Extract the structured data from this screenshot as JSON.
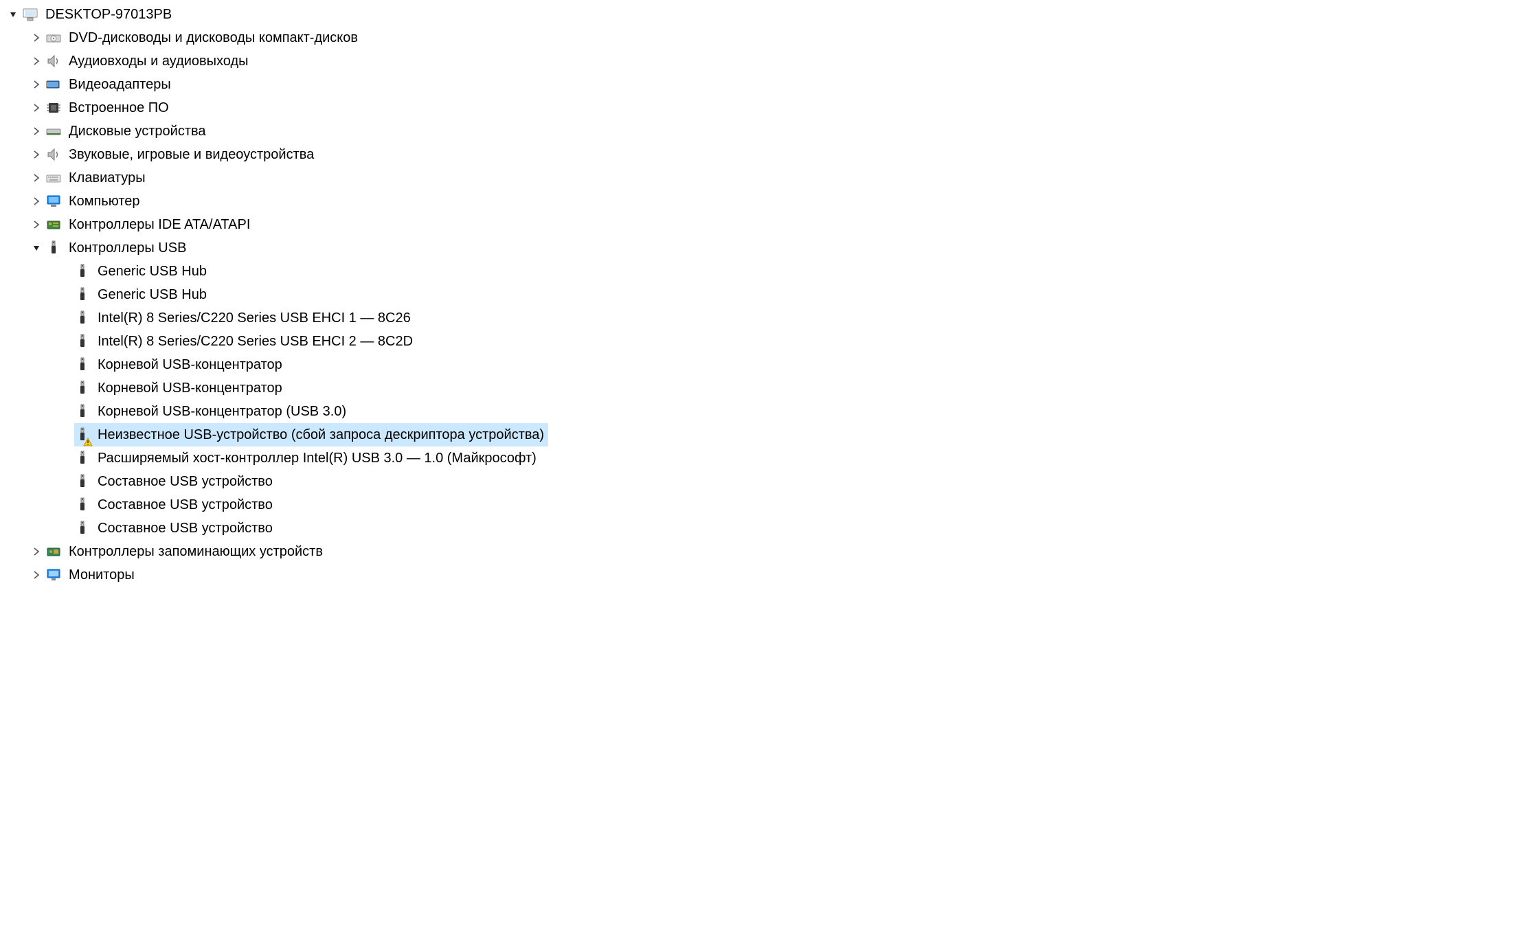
{
  "root": {
    "label": "DESKTOP-97013PB",
    "icon": "computer-icon",
    "expanded": true
  },
  "categories": [
    {
      "label": "DVD-дисководы и дисководы компакт-дисков",
      "icon": "dvd-drive-icon",
      "expanded": false
    },
    {
      "label": "Аудиовходы и аудиовыходы",
      "icon": "audio-io-icon",
      "expanded": false
    },
    {
      "label": "Видеоадаптеры",
      "icon": "display-adapter-icon",
      "expanded": false
    },
    {
      "label": "Встроенное ПО",
      "icon": "firmware-icon",
      "expanded": false
    },
    {
      "label": "Дисковые устройства",
      "icon": "disk-drive-icon",
      "expanded": false
    },
    {
      "label": "Звуковые, игровые и видеоустройства",
      "icon": "sound-device-icon",
      "expanded": false
    },
    {
      "label": "Клавиатуры",
      "icon": "keyboard-icon",
      "expanded": false
    },
    {
      "label": "Компьютер",
      "icon": "pc-icon",
      "expanded": false
    },
    {
      "label": "Контроллеры IDE ATA/ATAPI",
      "icon": "ide-controller-icon",
      "expanded": false
    },
    {
      "label": "Контроллеры USB",
      "icon": "usb-icon",
      "expanded": true,
      "children": [
        {
          "label": "Generic USB Hub",
          "icon": "usb-icon"
        },
        {
          "label": "Generic USB Hub",
          "icon": "usb-icon"
        },
        {
          "label": "Intel(R) 8 Series/C220 Series USB EHCI 1 — 8C26",
          "icon": "usb-icon"
        },
        {
          "label": "Intel(R) 8 Series/C220 Series USB EHCI 2 — 8C2D",
          "icon": "usb-icon"
        },
        {
          "label": "Корневой USB-концентратор",
          "icon": "usb-icon"
        },
        {
          "label": "Корневой USB-концентратор",
          "icon": "usb-icon"
        },
        {
          "label": "Корневой USB-концентратор (USB 3.0)",
          "icon": "usb-icon"
        },
        {
          "label": "Неизвестное USB-устройство (сбой запроса дескриптора устройства)",
          "icon": "usb-icon",
          "warning": true,
          "selected": true
        },
        {
          "label": "Расширяемый хост-контроллер Intel(R) USB 3.0 — 1.0 (Майкрософт)",
          "icon": "usb-icon"
        },
        {
          "label": "Составное USB устройство",
          "icon": "usb-icon"
        },
        {
          "label": "Составное USB устройство",
          "icon": "usb-icon"
        },
        {
          "label": "Составное USB устройство",
          "icon": "usb-icon"
        }
      ]
    },
    {
      "label": "Контроллеры запоминающих устройств",
      "icon": "storage-controller-icon",
      "expanded": false
    },
    {
      "label": "Мониторы",
      "icon": "monitor-icon",
      "expanded": false
    }
  ]
}
